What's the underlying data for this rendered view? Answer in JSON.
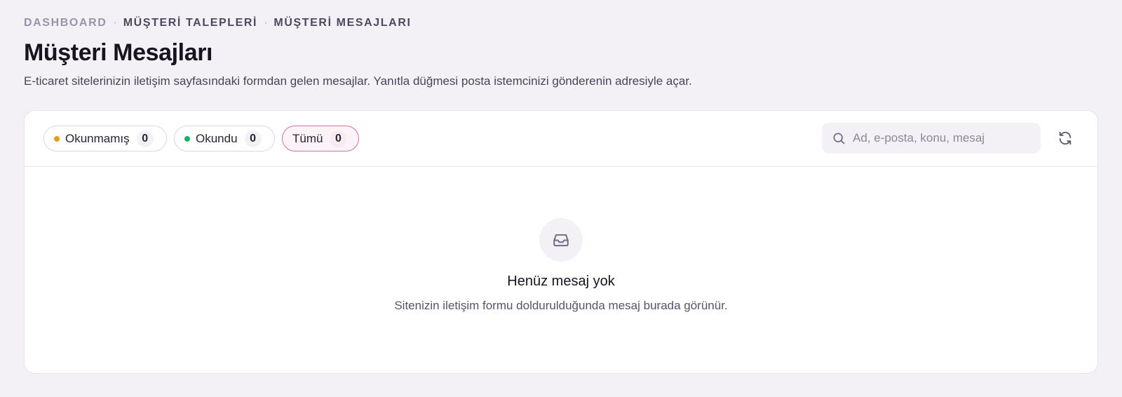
{
  "breadcrumb": {
    "items": [
      "DASHBOARD",
      "MÜŞTERİ TALEPLERİ",
      "MÜŞTERİ MESAJLARI"
    ],
    "separator": "·"
  },
  "page": {
    "title": "Müşteri Mesajları",
    "description": "E-ticaret sitelerinizin iletişim sayfasındaki formdan gelen mesajlar. Yanıtla düğmesi posta istemcinizi gönderenin adresiyle açar."
  },
  "filters": [
    {
      "label": "Okunmamış",
      "count": "0",
      "dot_color": "#e89a1e",
      "active": false
    },
    {
      "label": "Okundu",
      "count": "0",
      "dot_color": "#1fae6a",
      "active": false
    },
    {
      "label": "Tümü",
      "count": "0",
      "active": true
    }
  ],
  "search": {
    "placeholder": "Ad, e-posta, konu, mesaj",
    "value": "",
    "icon": "search-icon"
  },
  "refresh": {
    "icon": "refresh-icon"
  },
  "empty_state": {
    "icon": "inbox-icon",
    "title": "Henüz mesaj yok",
    "subtitle": "Sitenizin iletişim formu doldurulduğunda mesaj burada görünür."
  },
  "colors": {
    "background": "#f4f1f6",
    "card": "#ffffff",
    "accent_border": "#c9779f",
    "accent_bg": "#fbf3f7"
  }
}
